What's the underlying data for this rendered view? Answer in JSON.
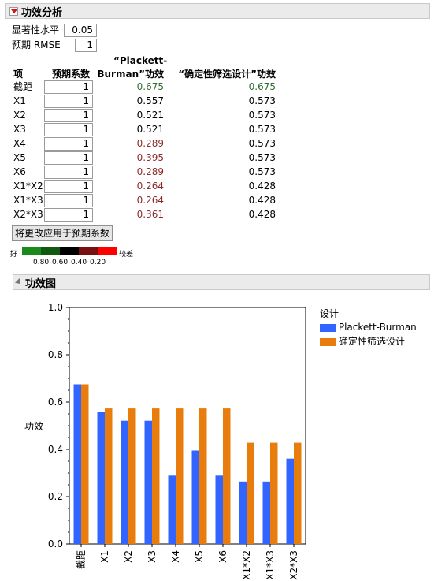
{
  "power_analysis": {
    "title": "功效分析",
    "alpha_label": "显著性水平",
    "alpha_value": "0.05",
    "rmse_label": "预期 RMSE",
    "rmse_value": "1",
    "col_term": "项",
    "col_coef": "预期系数",
    "col_pb": "“Plackett-Burman”功效",
    "col_pb_line1": "“Plackett-",
    "col_pb_line2": "Burman”功效",
    "col_dsd": "“确定性筛选设计”功效",
    "rows": [
      {
        "term": "截距",
        "coef": "1",
        "pb": "0.675",
        "dsd": "0.675",
        "pb_color": "green",
        "dsd_color": "green"
      },
      {
        "term": "X1",
        "coef": "1",
        "pb": "0.557",
        "dsd": "0.573",
        "pb_color": "dark",
        "dsd_color": "dark"
      },
      {
        "term": "X2",
        "coef": "1",
        "pb": "0.521",
        "dsd": "0.573",
        "pb_color": "dark",
        "dsd_color": "dark"
      },
      {
        "term": "X3",
        "coef": "1",
        "pb": "0.521",
        "dsd": "0.573",
        "pb_color": "dark",
        "dsd_color": "dark"
      },
      {
        "term": "X4",
        "coef": "1",
        "pb": "0.289",
        "dsd": "0.573",
        "pb_color": "red",
        "dsd_color": "dark"
      },
      {
        "term": "X5",
        "coef": "1",
        "pb": "0.395",
        "dsd": "0.573",
        "pb_color": "red",
        "dsd_color": "dark"
      },
      {
        "term": "X6",
        "coef": "1",
        "pb": "0.289",
        "dsd": "0.573",
        "pb_color": "red",
        "dsd_color": "dark"
      },
      {
        "term": "X1*X2",
        "coef": "1",
        "pb": "0.264",
        "dsd": "0.428",
        "pb_color": "red",
        "dsd_color": "dark"
      },
      {
        "term": "X1*X3",
        "coef": "1",
        "pb": "0.264",
        "dsd": "0.428",
        "pb_color": "red",
        "dsd_color": "dark"
      },
      {
        "term": "X2*X3",
        "coef": "1",
        "pb": "0.361",
        "dsd": "0.428",
        "pb_color": "red",
        "dsd_color": "dark"
      }
    ],
    "apply_button": "将更改应用于预期系数",
    "color_scale": {
      "good_label": "好",
      "bad_label": "较差",
      "ticks": [
        "0.80",
        "0.60",
        "0.40",
        "0.20"
      ],
      "colors": [
        "#1a8a1a",
        "#0f5a0f",
        "#000000",
        "#7a1010",
        "#ff0000"
      ]
    }
  },
  "power_plot": {
    "title": "功效图",
    "ylabel": "功效",
    "legend_title": "设计",
    "colors": {
      "pb": "#3264ff",
      "dsd": "#e87c0c"
    }
  },
  "chart_data": {
    "type": "bar",
    "categories": [
      "截距",
      "X1",
      "X2",
      "X3",
      "X4",
      "X5",
      "X6",
      "X1*X2",
      "X1*X3",
      "X2*X3"
    ],
    "series": [
      {
        "name": "Plackett-Burman",
        "values": [
          0.675,
          0.557,
          0.521,
          0.521,
          0.289,
          0.395,
          0.289,
          0.264,
          0.264,
          0.361
        ]
      },
      {
        "name": "确定性筛选设计",
        "values": [
          0.675,
          0.573,
          0.573,
          0.573,
          0.573,
          0.573,
          0.573,
          0.428,
          0.428,
          0.428
        ]
      }
    ],
    "ylabel": "功效",
    "ylim": [
      0,
      1
    ],
    "yticks": [
      "0.0",
      "0.2",
      "0.4",
      "0.6",
      "0.8",
      "1.0"
    ],
    "legend_title": "设计",
    "legend_position": "right"
  }
}
